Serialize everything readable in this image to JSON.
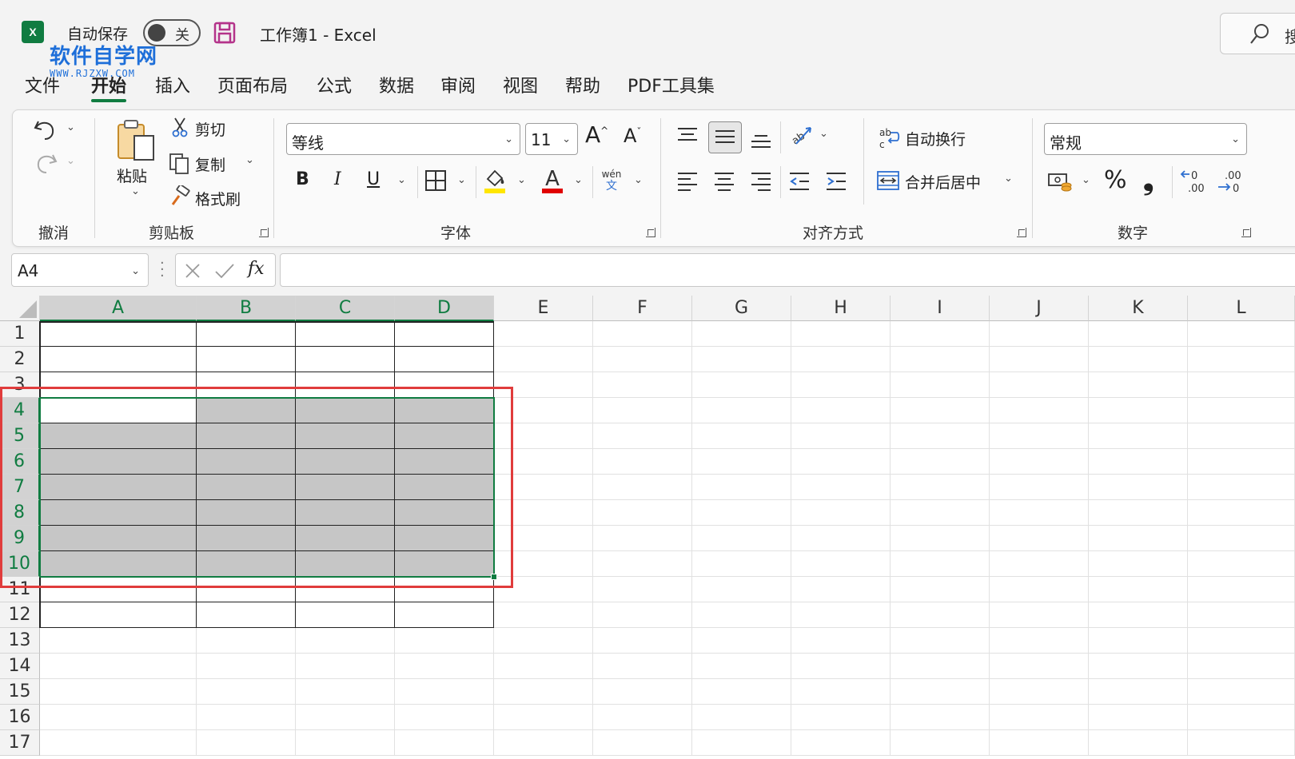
{
  "titlebar": {
    "autosave_label": "自动保存",
    "autosave_state": "关",
    "workbook_title": "工作簿1  -  Excel",
    "search_text": "搜",
    "watermark_main": "软件自学网",
    "watermark_url": "WWW.RJZXW.COM"
  },
  "tabs": [
    "文件",
    "开始",
    "插入",
    "页面布局",
    "公式",
    "数据",
    "审阅",
    "视图",
    "帮助",
    "PDF工具集"
  ],
  "active_tab": "开始",
  "ribbon": {
    "undo_group": "撤消",
    "clipboard": {
      "group": "剪贴板",
      "paste": "粘贴",
      "cut": "剪切",
      "copy": "复制",
      "format_painter": "格式刷"
    },
    "font": {
      "group": "字体",
      "font_name": "等线",
      "font_size": "11",
      "bold": "B",
      "italic": "I",
      "underline": "U",
      "phonetic_top": "wén",
      "phonetic_bottom": "文"
    },
    "alignment": {
      "group": "对齐方式",
      "wrap_text": "自动换行",
      "merge_center": "合并后居中"
    },
    "number": {
      "group": "数字",
      "format": "常规",
      "percent": "%",
      "comma": "❟"
    }
  },
  "formula_bar": {
    "name_box": "A4",
    "fx": "fx",
    "formula": ""
  },
  "grid": {
    "columns": [
      "A",
      "B",
      "C",
      "D",
      "E",
      "F",
      "G",
      "H",
      "I",
      "J",
      "K",
      "L"
    ],
    "rows": [
      "1",
      "2",
      "3",
      "4",
      "5",
      "6",
      "7",
      "8",
      "9",
      "10",
      "11",
      "12",
      "13",
      "14",
      "15",
      "16",
      "17"
    ],
    "selected_columns": [
      "A",
      "B",
      "C",
      "D"
    ],
    "selected_rows": [
      "4",
      "5",
      "6",
      "7",
      "8",
      "9",
      "10"
    ],
    "active_cell": "A4"
  },
  "colors": {
    "accent": "#107c41",
    "highlight_yellow": "#ffe600",
    "font_red": "#e00000",
    "annotation_red": "#e03c3c",
    "shade_gray": "#c6c6c6"
  }
}
